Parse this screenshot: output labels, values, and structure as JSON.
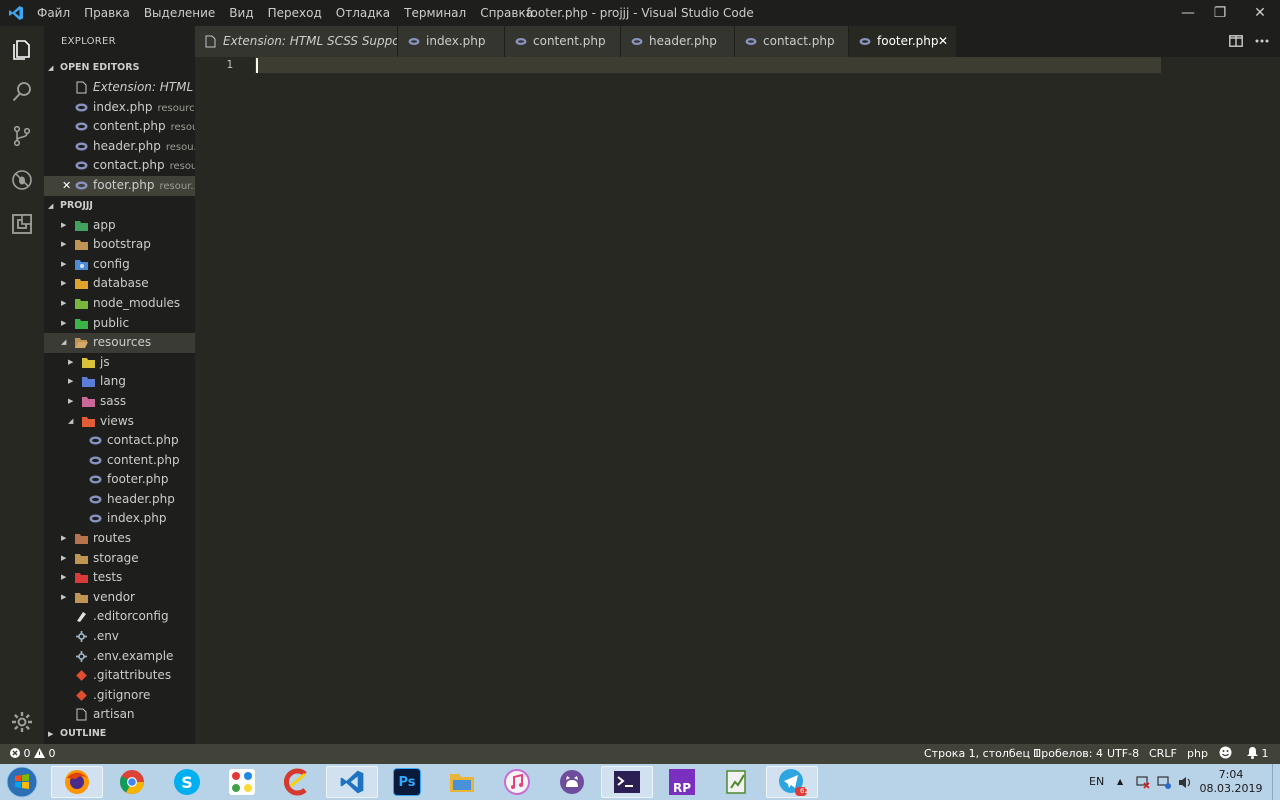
{
  "titlebar": {
    "menu": [
      "Файл",
      "Правка",
      "Выделение",
      "Вид",
      "Переход",
      "Отладка",
      "Терминал",
      "Справка"
    ],
    "window_title": "footer.php - projjj - Visual Studio Code",
    "minimize": "—",
    "restore": "❐",
    "close": "✕"
  },
  "sidebar": {
    "title": "EXPLORER",
    "open_editors": {
      "label": "OPEN EDITORS",
      "items": [
        {
          "name": "Extension: HTML S...",
          "desc": ""
        },
        {
          "name": "index.php",
          "desc": "resourc..."
        },
        {
          "name": "content.php",
          "desc": "resou..."
        },
        {
          "name": "header.php",
          "desc": "resou..."
        },
        {
          "name": "contact.php",
          "desc": "resou..."
        },
        {
          "name": "footer.php",
          "desc": "resour..."
        }
      ],
      "close_glyph": "✕"
    },
    "project": {
      "label": "PROJJJ",
      "items": [
        {
          "name": "app"
        },
        {
          "name": "bootstrap"
        },
        {
          "name": "config"
        },
        {
          "name": "database"
        },
        {
          "name": "node_modules"
        },
        {
          "name": "public"
        },
        {
          "name": "resources"
        },
        {
          "name": "js"
        },
        {
          "name": "lang"
        },
        {
          "name": "sass"
        },
        {
          "name": "views"
        },
        {
          "name": "contact.php"
        },
        {
          "name": "content.php"
        },
        {
          "name": "footer.php"
        },
        {
          "name": "header.php"
        },
        {
          "name": "index.php"
        },
        {
          "name": "routes"
        },
        {
          "name": "storage"
        },
        {
          "name": "tests"
        },
        {
          "name": "vendor"
        },
        {
          "name": ".editorconfig"
        },
        {
          "name": ".env"
        },
        {
          "name": ".env.example"
        },
        {
          "name": ".gitattributes"
        },
        {
          "name": ".gitignore"
        },
        {
          "name": "artisan"
        }
      ]
    },
    "outline": {
      "label": "OUTLINE"
    }
  },
  "tabs": [
    {
      "label": "Extension: HTML SCSS Support"
    },
    {
      "label": "index.php"
    },
    {
      "label": "content.php"
    },
    {
      "label": "header.php"
    },
    {
      "label": "contact.php"
    },
    {
      "label": "footer.php",
      "close": "✕"
    }
  ],
  "editor": {
    "line_number": "1"
  },
  "statusbar": {
    "errors": "0",
    "warnings": "0",
    "position": "Строка 1, столбец 1",
    "spaces": "Пробелов: 4",
    "encoding": "UTF-8",
    "eol": "CRLF",
    "language": "php",
    "notifications": "1"
  },
  "taskbar": {
    "apps": [
      "firefox",
      "chrome",
      "skype",
      "app-grid",
      "ccleaner",
      "vscode",
      "photoshop",
      "file-explorer",
      "itunes",
      "github",
      "terminal",
      "rp",
      "notepad",
      "telegram"
    ],
    "ps_label": "Ps",
    "rp_label": "RP",
    "skype_label": "S",
    "telegram_badge": "62",
    "lang": "EN",
    "time": "7:04",
    "date": "08.03.2019",
    "colors": {
      "taskbar": "#b8d2e8",
      "statusbar": "#414339",
      "sidebar": "#1e1f1c",
      "editor": "#272822"
    }
  }
}
